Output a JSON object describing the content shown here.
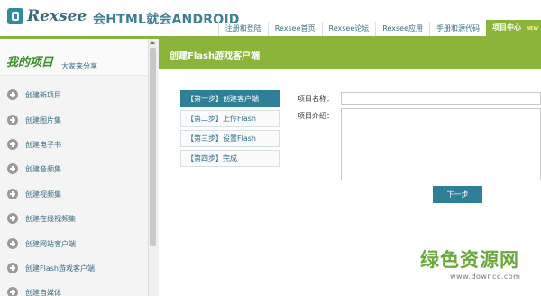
{
  "header": {
    "logo_text": "Rexsee",
    "slogan": "会HTML就会ANDROID",
    "nav": [
      {
        "label": "注册和登陆"
      },
      {
        "label": "Rexsee首页"
      },
      {
        "label": "Rexsee论坛"
      },
      {
        "label": "Rexsee应用"
      },
      {
        "label": "手册和源代码"
      },
      {
        "label": "项目中心",
        "badge": "NEW",
        "active": true
      }
    ]
  },
  "sidebar": {
    "title": "我的项目",
    "subtitle": "大家来分享",
    "items": [
      {
        "label": "创建新项目",
        "icon": "plus-circle-icon"
      },
      {
        "label": "创建图片集",
        "icon": "plus-circle-icon"
      },
      {
        "label": "创建电子书",
        "icon": "plus-circle-icon"
      },
      {
        "label": "创建音频集",
        "icon": "plus-circle-icon"
      },
      {
        "label": "创建视频集",
        "icon": "plus-circle-icon"
      },
      {
        "label": "创建在线视频集",
        "icon": "plus-circle-icon"
      },
      {
        "label": "创建网站客户端",
        "icon": "plus-circle-icon"
      },
      {
        "label": "创建Flash游戏客户端",
        "icon": "plus-circle-icon"
      },
      {
        "label": "创建自媒体",
        "icon": "plus-circle-icon"
      }
    ]
  },
  "main": {
    "title": "创建Flash游戏客户端",
    "steps": [
      {
        "label": "【第一步】创建客户端",
        "active": true
      },
      {
        "label": "【第二步】上传Flash"
      },
      {
        "label": "【第三步】设置Flash"
      },
      {
        "label": "【第四步】完成"
      }
    ],
    "form": {
      "name_label": "项目名称：",
      "name_value": "",
      "intro_label": "项目介绍：",
      "intro_value": "",
      "next_label": "下一步"
    }
  },
  "watermark": {
    "logo": "绿色资源网",
    "url": "www.downcc.com"
  },
  "colors": {
    "accent_green": "#8ab43a",
    "accent_teal": "#2f7f97",
    "link_blue": "#3a6f83"
  }
}
